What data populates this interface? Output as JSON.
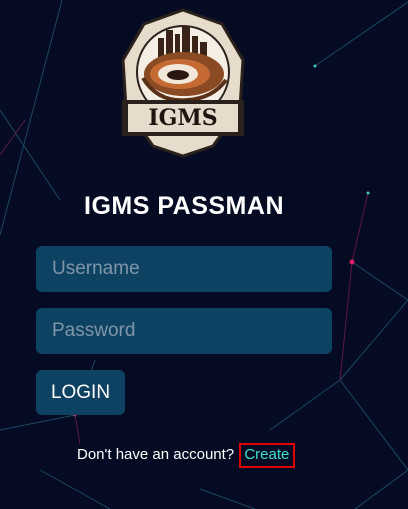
{
  "logo": {
    "label": "IGMS"
  },
  "title": "IGMS PASSMAN",
  "form": {
    "username_placeholder": "Username",
    "password_placeholder": "Password",
    "login_label": "LOGIN"
  },
  "signup": {
    "prompt": "Don't have an account?",
    "link_label": "Create"
  },
  "colors": {
    "background": "#050b22",
    "field": "#0e4263",
    "link": "#3fe0d2",
    "highlight": "#e00000"
  }
}
